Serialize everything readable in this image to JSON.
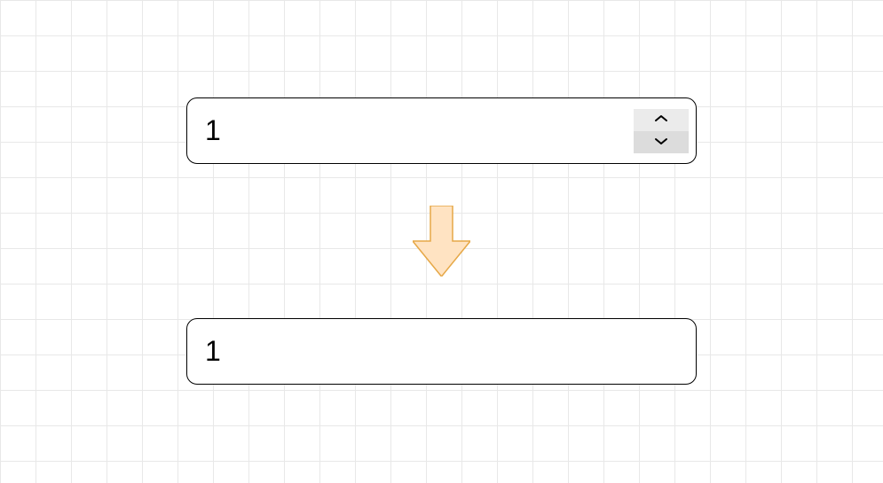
{
  "top_input": {
    "value": "1",
    "has_spinner": true
  },
  "bottom_input": {
    "value": "1",
    "has_spinner": false
  },
  "arrow": {
    "fill": "#ffe3c2",
    "stroke": "#e6a847"
  }
}
